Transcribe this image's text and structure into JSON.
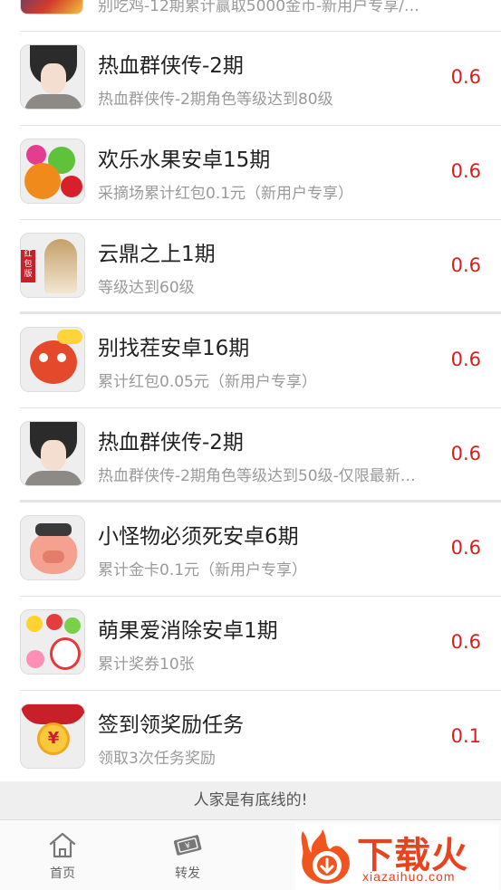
{
  "top_partial": {
    "subtitle": "别吃鸡-12期累计赢取5000金币-新用户专享/…"
  },
  "tasks": [
    {
      "title": "热血群侠传-2期",
      "subtitle": "热血群侠传-2期角色等级达到80级",
      "reward": "0.6",
      "icon": "hero-portrait-icon"
    },
    {
      "title": "欢乐水果安卓15期",
      "subtitle": "采摘场累计红包0.1元（新用户专享）",
      "reward": "0.6",
      "icon": "fruit-game-icon"
    },
    {
      "title": "云鼎之上1期",
      "subtitle": "等级达到60级",
      "reward": "0.6",
      "icon": "yunding-game-icon",
      "icon_tag": "红包版"
    },
    {
      "title": "别找茬安卓16期",
      "subtitle": "累计红包0.05元（新用户专享）",
      "reward": "0.6",
      "icon": "monkey-game-icon"
    },
    {
      "title": "热血群侠传-2期",
      "subtitle": "热血群侠传-2期角色等级达到50级-仅限最新…",
      "reward": "0.6",
      "icon": "hero-portrait-icon"
    },
    {
      "title": "小怪物必须死安卓6期",
      "subtitle": "累计金卡0.1元（新用户专享）",
      "reward": "0.6",
      "icon": "pig-monster-game-icon"
    },
    {
      "title": "萌果爱消除安卓1期",
      "subtitle": "累计奖券10张",
      "reward": "0.6",
      "icon": "match-fruit-game-icon"
    },
    {
      "title": "签到领奖励任务",
      "subtitle": "领取3次任务奖励",
      "reward": "0.1",
      "icon": "red-envelope-icon",
      "icon_symbol": "¥"
    }
  ],
  "footer_note": "人家是有底线的!",
  "tabbar": {
    "tabs": [
      {
        "label": "首页",
        "icon": "home-icon"
      },
      {
        "label": "转发",
        "icon": "ticket-icon"
      }
    ]
  },
  "watermark": {
    "title": "下载火",
    "url": "xiazaihuo.com"
  },
  "colors": {
    "reward": "#e01b1b",
    "divider": "#e2e2e2",
    "brand_watermark": "#e8421f"
  }
}
